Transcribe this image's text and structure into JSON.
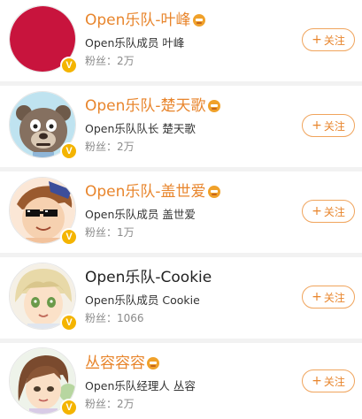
{
  "members": [
    {
      "name": "Open乐队-叶峰",
      "name_color": "orange",
      "desc": "Open乐队成员 叶峰",
      "fans": "粉丝：2万",
      "follow_icon": "+",
      "follow_label": "关注"
    },
    {
      "name": "Open乐队-楚天歌",
      "name_color": "orange",
      "desc": "Open乐队队长 楚天歌",
      "fans": "粉丝：2万",
      "follow_icon": "+",
      "follow_label": "关注"
    },
    {
      "name": "Open乐队-盖世爱",
      "name_color": "orange",
      "desc": "Open乐队成员 盖世爱",
      "fans": "粉丝：1万",
      "follow_icon": "+",
      "follow_label": "关注"
    },
    {
      "name": "Open乐队-Cookie",
      "name_color": "black",
      "desc": "Open乐队成员 Cookie",
      "fans": "粉丝：1066",
      "follow_icon": "+",
      "follow_label": "关注"
    },
    {
      "name": "丛容容容",
      "name_color": "orange",
      "desc": "Open乐队经理人 丛容",
      "fans": "粉丝：2万",
      "follow_icon": "+",
      "follow_label": "关注"
    }
  ],
  "verified_badge": "V",
  "colors": {
    "accent": "#e8852c",
    "badge": "#f4b400",
    "follow_border": "#f0a45c"
  }
}
